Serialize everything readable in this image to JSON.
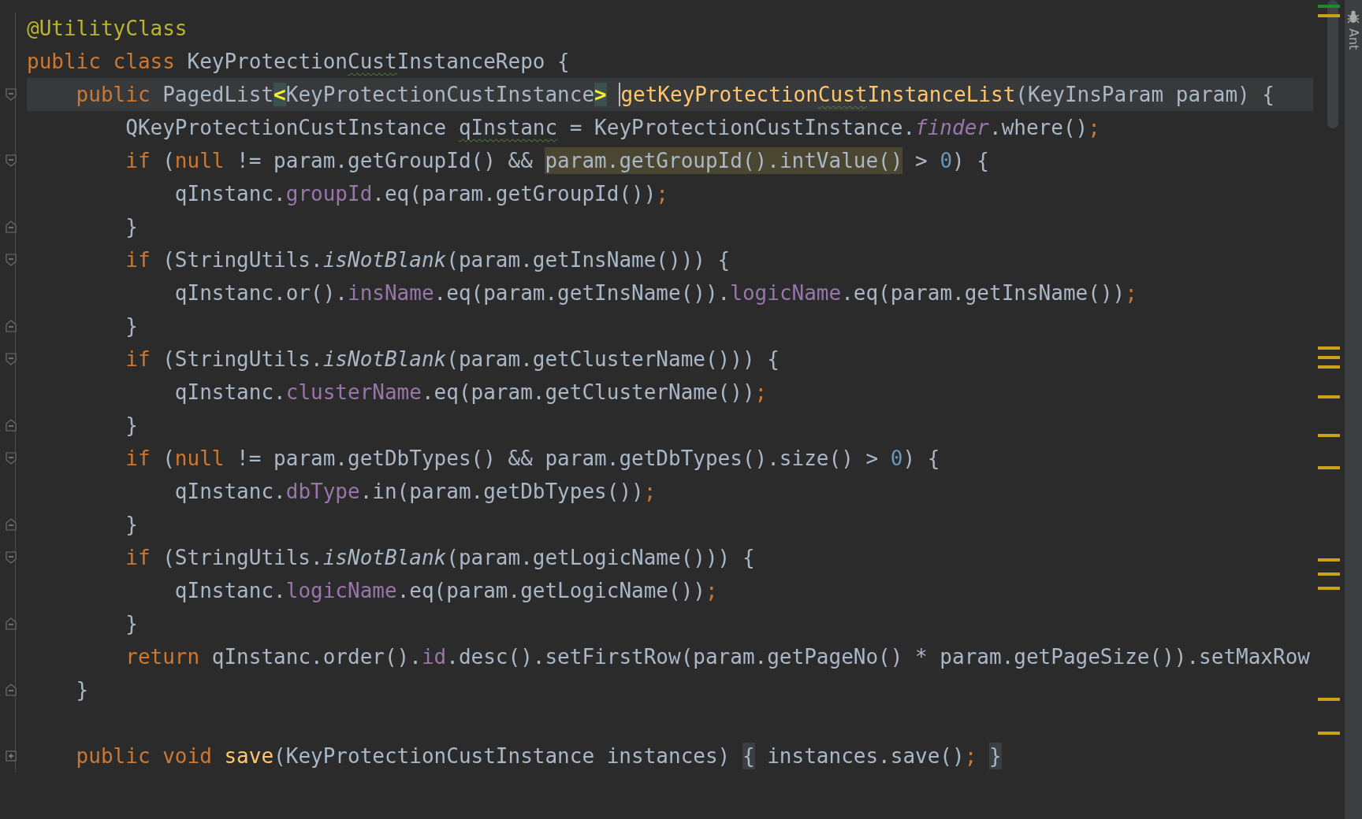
{
  "editor": {
    "lines": [
      {
        "current": false,
        "kind": "plain",
        "tokens": [
          {
            "t": "@UtilityClass",
            "kind": "a"
          }
        ]
      },
      {
        "current": false,
        "kind": "plain",
        "tokens": [
          {
            "t": "public class ",
            "kind": "k"
          },
          {
            "t": "KeyProtection",
            "kind": "p"
          },
          {
            "t": "Cust",
            "kind": "pt"
          },
          {
            "t": "InstanceRepo {",
            "kind": "p"
          }
        ]
      },
      {
        "current": true,
        "kind": "fold_start",
        "tokens": [
          {
            "t": "    public ",
            "kind": "k"
          },
          {
            "t": "PagedList",
            "kind": "p"
          },
          {
            "t": "<",
            "kind": "br"
          },
          {
            "t": "KeyProtectionCustInstance",
            "kind": "p"
          },
          {
            "t": ">",
            "kind": "br"
          },
          {
            "kind": "caret"
          },
          {
            "t": "getKeyProtection",
            "kind": "m"
          },
          {
            "t": "Cust",
            "kind": "mt"
          },
          {
            "t": "InstanceList",
            "kind": "m"
          },
          {
            "t": "(KeyInsParam param) {",
            "kind": "p"
          }
        ]
      },
      {
        "current": false,
        "kind": "plain",
        "tokens": [
          {
            "t": "        QKeyProtectionCustInstance ",
            "kind": "p"
          },
          {
            "t": "qInstanc",
            "kind": "pt"
          },
          {
            "t": " = KeyProtectionCustInstance.",
            "kind": "p"
          },
          {
            "t": "finder",
            "kind": "fi"
          },
          {
            "t": ".where()",
            "kind": "p"
          },
          {
            "t": ";",
            "kind": "k"
          }
        ]
      },
      {
        "current": false,
        "kind": "fold_start",
        "tokens": [
          {
            "t": "        if ",
            "kind": "k"
          },
          {
            "t": "(",
            "kind": "p"
          },
          {
            "t": "null",
            "kind": "k"
          },
          {
            "t": " != param.getGroupId() && ",
            "kind": "p"
          },
          {
            "t": "param.getGroupId().intValue()",
            "kind": "hl"
          },
          {
            "t": " > ",
            "kind": "p"
          },
          {
            "t": "0",
            "kind": "n"
          },
          {
            "t": ") {",
            "kind": "p"
          }
        ]
      },
      {
        "current": false,
        "kind": "plain",
        "tokens": [
          {
            "t": "            qInstanc.",
            "kind": "p"
          },
          {
            "t": "groupId",
            "kind": "f"
          },
          {
            "t": ".eq(param.getGroupId())",
            "kind": "p"
          },
          {
            "t": ";",
            "kind": "k"
          }
        ]
      },
      {
        "current": false,
        "kind": "fold_end",
        "tokens": [
          {
            "t": "        }",
            "kind": "p"
          }
        ]
      },
      {
        "current": false,
        "kind": "fold_start",
        "tokens": [
          {
            "t": "        if ",
            "kind": "k"
          },
          {
            "t": "(StringUtils.",
            "kind": "p"
          },
          {
            "t": "isNotBlank",
            "kind": "s"
          },
          {
            "t": "(param.getInsName())) {",
            "kind": "p"
          }
        ]
      },
      {
        "current": false,
        "kind": "plain",
        "tokens": [
          {
            "t": "            qInstanc.or().",
            "kind": "p"
          },
          {
            "t": "insName",
            "kind": "f"
          },
          {
            "t": ".eq(param.getInsName()).",
            "kind": "p"
          },
          {
            "t": "logicName",
            "kind": "f"
          },
          {
            "t": ".eq(param.getInsName())",
            "kind": "p"
          },
          {
            "t": ";",
            "kind": "k"
          }
        ]
      },
      {
        "current": false,
        "kind": "fold_end",
        "tokens": [
          {
            "t": "        }",
            "kind": "p"
          }
        ]
      },
      {
        "current": false,
        "kind": "fold_start",
        "tokens": [
          {
            "t": "        if ",
            "kind": "k"
          },
          {
            "t": "(StringUtils.",
            "kind": "p"
          },
          {
            "t": "isNotBlank",
            "kind": "s"
          },
          {
            "t": "(param.getClusterName())) {",
            "kind": "p"
          }
        ]
      },
      {
        "current": false,
        "kind": "plain",
        "tokens": [
          {
            "t": "            qInstanc.",
            "kind": "p"
          },
          {
            "t": "clusterName",
            "kind": "f"
          },
          {
            "t": ".eq(param.getClusterName())",
            "kind": "p"
          },
          {
            "t": ";",
            "kind": "k"
          }
        ]
      },
      {
        "current": false,
        "kind": "fold_end",
        "tokens": [
          {
            "t": "        }",
            "kind": "p"
          }
        ]
      },
      {
        "current": false,
        "kind": "fold_start",
        "tokens": [
          {
            "t": "        if ",
            "kind": "k"
          },
          {
            "t": "(",
            "kind": "p"
          },
          {
            "t": "null",
            "kind": "k"
          },
          {
            "t": " != param.getDbTypes() && param.getDbTypes().size() > ",
            "kind": "p"
          },
          {
            "t": "0",
            "kind": "n"
          },
          {
            "t": ") {",
            "kind": "p"
          }
        ]
      },
      {
        "current": false,
        "kind": "plain",
        "tokens": [
          {
            "t": "            qInstanc.",
            "kind": "p"
          },
          {
            "t": "dbType",
            "kind": "f"
          },
          {
            "t": ".in(param.getDbTypes())",
            "kind": "p"
          },
          {
            "t": ";",
            "kind": "k"
          }
        ]
      },
      {
        "current": false,
        "kind": "fold_end",
        "tokens": [
          {
            "t": "        }",
            "kind": "p"
          }
        ]
      },
      {
        "current": false,
        "kind": "fold_start",
        "tokens": [
          {
            "t": "        if ",
            "kind": "k"
          },
          {
            "t": "(StringUtils.",
            "kind": "p"
          },
          {
            "t": "isNotBlank",
            "kind": "s"
          },
          {
            "t": "(param.getLogicName())) {",
            "kind": "p"
          }
        ]
      },
      {
        "current": false,
        "kind": "plain",
        "tokens": [
          {
            "t": "            qInstanc.",
            "kind": "p"
          },
          {
            "t": "logicName",
            "kind": "f"
          },
          {
            "t": ".eq(param.getLogicName())",
            "kind": "p"
          },
          {
            "t": ";",
            "kind": "k"
          }
        ]
      },
      {
        "current": false,
        "kind": "fold_end",
        "tokens": [
          {
            "t": "        }",
            "kind": "p"
          }
        ]
      },
      {
        "current": false,
        "kind": "plain",
        "tokens": [
          {
            "t": "        return ",
            "kind": "k"
          },
          {
            "t": "qInstanc.order().",
            "kind": "p"
          },
          {
            "t": "id",
            "kind": "f"
          },
          {
            "t": ".desc().setFirstRow(param.getPageNo() * param.getPageSize()).setMaxRow",
            "kind": "p"
          }
        ]
      },
      {
        "current": false,
        "kind": "fold_end",
        "tokens": [
          {
            "t": "    }",
            "kind": "p"
          }
        ]
      },
      {
        "current": false,
        "kind": "plain"
      },
      {
        "current": false,
        "kind": "folded",
        "tokens": [
          {
            "t": "    public void ",
            "kind": "k"
          },
          {
            "t": "save",
            "kind": "m"
          },
          {
            "t": "(KeyProtectionCustInstance instances) ",
            "kind": "p"
          },
          {
            "t": "{",
            "kind": "fold"
          },
          {
            "t": " instances.save()",
            "kind": "p"
          },
          {
            "t": "; ",
            "kind": "k"
          },
          {
            "t": "}",
            "kind": "fold"
          }
        ]
      }
    ]
  },
  "side_panel": {
    "label": "Ant"
  }
}
